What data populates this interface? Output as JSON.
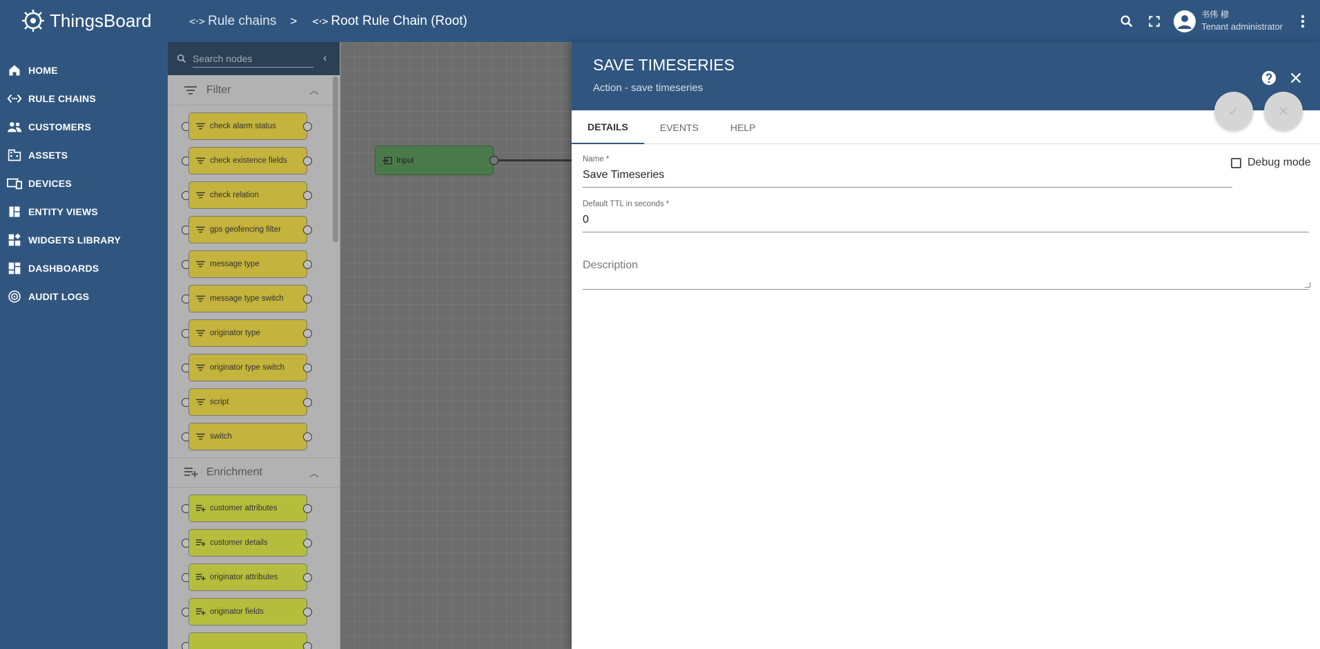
{
  "app": {
    "name": "ThingsBoard"
  },
  "breadcrumb": {
    "items": [
      {
        "label": "Rule chains",
        "icon": "rule-chain-icon"
      },
      {
        "label": "Root Rule Chain (Root)",
        "icon": "rule-chain-icon"
      }
    ],
    "separator": ">"
  },
  "user": {
    "name": "书伟 穆",
    "role": "Tenant administrator"
  },
  "sidebar": {
    "items": [
      {
        "label": "HOME",
        "icon": "home-icon"
      },
      {
        "label": "RULE CHAINS",
        "icon": "rule-chain-icon"
      },
      {
        "label": "CUSTOMERS",
        "icon": "customers-icon"
      },
      {
        "label": "ASSETS",
        "icon": "assets-icon"
      },
      {
        "label": "DEVICES",
        "icon": "devices-icon"
      },
      {
        "label": "ENTITY VIEWS",
        "icon": "entity-views-icon"
      },
      {
        "label": "WIDGETS LIBRARY",
        "icon": "widgets-icon"
      },
      {
        "label": "DASHBOARDS",
        "icon": "dashboards-icon"
      },
      {
        "label": "AUDIT LOGS",
        "icon": "audit-icon"
      }
    ]
  },
  "library": {
    "search_placeholder": "Search nodes",
    "sections": [
      {
        "title": "Filter",
        "nodes": [
          "check alarm status",
          "check existence fields",
          "check relation",
          "gps geofencing filter",
          "message type",
          "message type switch",
          "originator type",
          "originator type switch",
          "script",
          "switch"
        ]
      },
      {
        "title": "Enrichment",
        "nodes": [
          "customer attributes",
          "customer details",
          "originator attributes",
          "originator fields"
        ]
      }
    ]
  },
  "canvas": {
    "input_node_label": "Input"
  },
  "details": {
    "title": "SAVE TIMESERIES",
    "subtitle": "Action - save timeseries",
    "tabs": [
      "DETAILS",
      "EVENTS",
      "HELP"
    ],
    "active_tab": "DETAILS",
    "name_label": "Name *",
    "name_value": "Save Timeseries",
    "debug_label": "Debug mode",
    "debug_checked": false,
    "ttl_label": "Default TTL in seconds *",
    "ttl_value": "0",
    "description_placeholder": "Description"
  },
  "colors": {
    "primary": "#305680",
    "filter_node": "#c4b33c",
    "enrichment_node": "#b5be3c",
    "input_node": "#4a7a4a"
  }
}
